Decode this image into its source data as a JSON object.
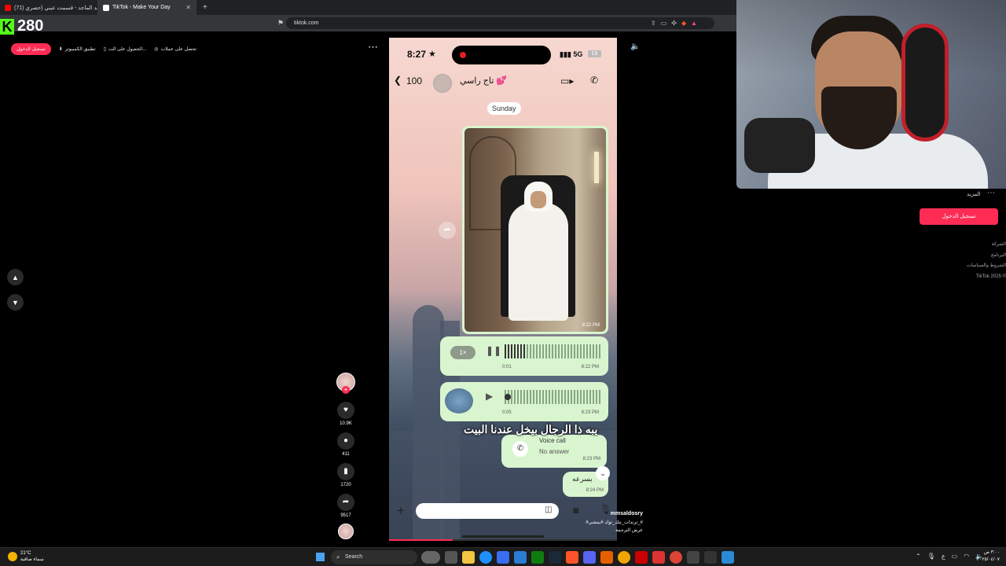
{
  "browser": {
    "tabs": [
      {
        "label": "(71) راشد الماجد - قسمت عيني (حصري",
        "color": "#ff0000",
        "active": false
      },
      {
        "label": "TikTok - Make Your Day",
        "color": "#ffffff",
        "active": true
      }
    ],
    "url": "tiktok.com",
    "new_tab": "+"
  },
  "overlay": {
    "kick_logo": "K",
    "viewer_count": "280"
  },
  "tiktok": {
    "login_label": "تسجيل الدخول",
    "top_links": [
      "تطبيق الكمبيوتر",
      "الحصول على الت...",
      "تحصل على عملات"
    ],
    "more_text": "المزيد",
    "right_login_label": "تسجيل الدخول",
    "footer_links": [
      "الشركة",
      "البرنامج",
      "الشروط والسياسات",
      "TikTok 2025 ©"
    ],
    "actions": {
      "likes": "10.9K",
      "comments": "411",
      "saves": "1720",
      "shares": "9517"
    },
    "author": {
      "username": "mmsaldosry",
      "hashtags": "#ترندات_تيك_توك #بيتشي_#",
      "translate": "عرض الترجمة"
    },
    "progress": 0.28
  },
  "video": {
    "time": "8:27",
    "signal": "5G",
    "battery": "19",
    "back_count": "100",
    "contact_name": "تاج راسي 💕",
    "day": "Sunday",
    "photo_time": "8:22 PM",
    "voice1": {
      "speed": "1×",
      "duration": "0:01",
      "time": "8:22 PM"
    },
    "voice2": {
      "duration": "0:05",
      "time": "8:23 PM"
    },
    "caption": "يبه ذا الرجال بيخل عندنا البيت",
    "voice_call": {
      "title": "Voice call",
      "status": "No answer",
      "time": "8:23 PM"
    },
    "fast_msg": {
      "text": "بسرعه",
      "time": "8:24 PM"
    }
  },
  "taskbar": {
    "weather_temp": "21°C",
    "weather_desc": "سماء صافية",
    "search_label": "Search",
    "clock_time": "٣:٠٠ ص",
    "clock_date": "٢٠٢٥/٠٤/٠٧",
    "lang": "ع"
  }
}
